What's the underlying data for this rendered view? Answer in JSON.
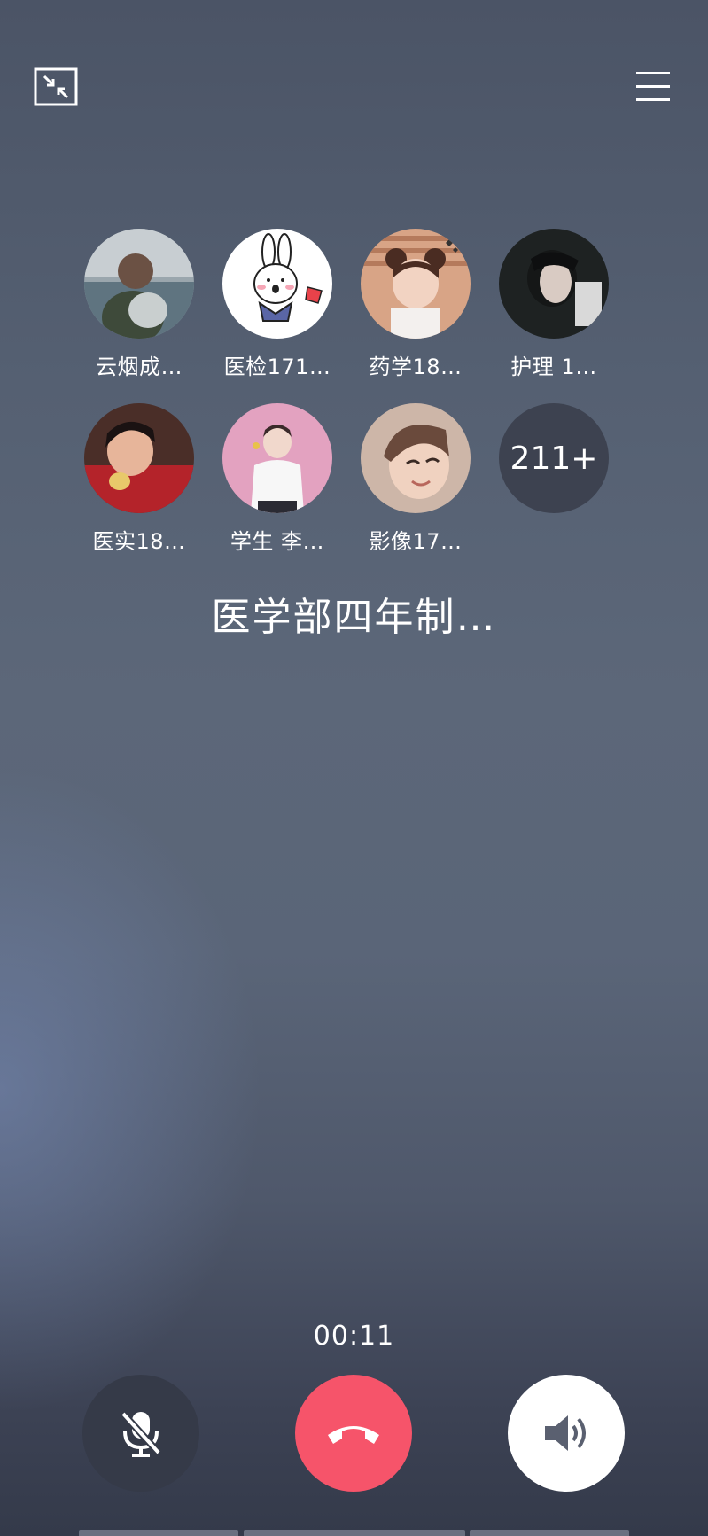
{
  "header": {
    "minimize_icon": "minimize-window-icon",
    "menu_icon": "hamburger-menu-icon"
  },
  "members": [
    {
      "name": "云烟成…",
      "avatar": "photo-man-with-pet"
    },
    {
      "name": "医检171…",
      "avatar": "cartoon-bunny"
    },
    {
      "name": "药学18…",
      "avatar": "photo-girl-with-buns"
    },
    {
      "name": "护理  1…",
      "avatar": "photo-dark-portrait"
    },
    {
      "name": "医实18…",
      "avatar": "photo-kid-eating"
    },
    {
      "name": "学生  李…",
      "avatar": "photo-person-pink-bg"
    },
    {
      "name": "影像17…",
      "avatar": "photo-smiling-girl"
    }
  ],
  "more_count": "211+",
  "group_name": "医学部四年制…",
  "call": {
    "timer": "00:11",
    "mute_icon": "microphone-muted-icon",
    "hangup_icon": "phone-hangup-icon",
    "speaker_icon": "speaker-icon"
  },
  "colors": {
    "hangup": "#f6546a",
    "mute_bg": "#353a48",
    "speaker_bg": "#ffffff"
  }
}
